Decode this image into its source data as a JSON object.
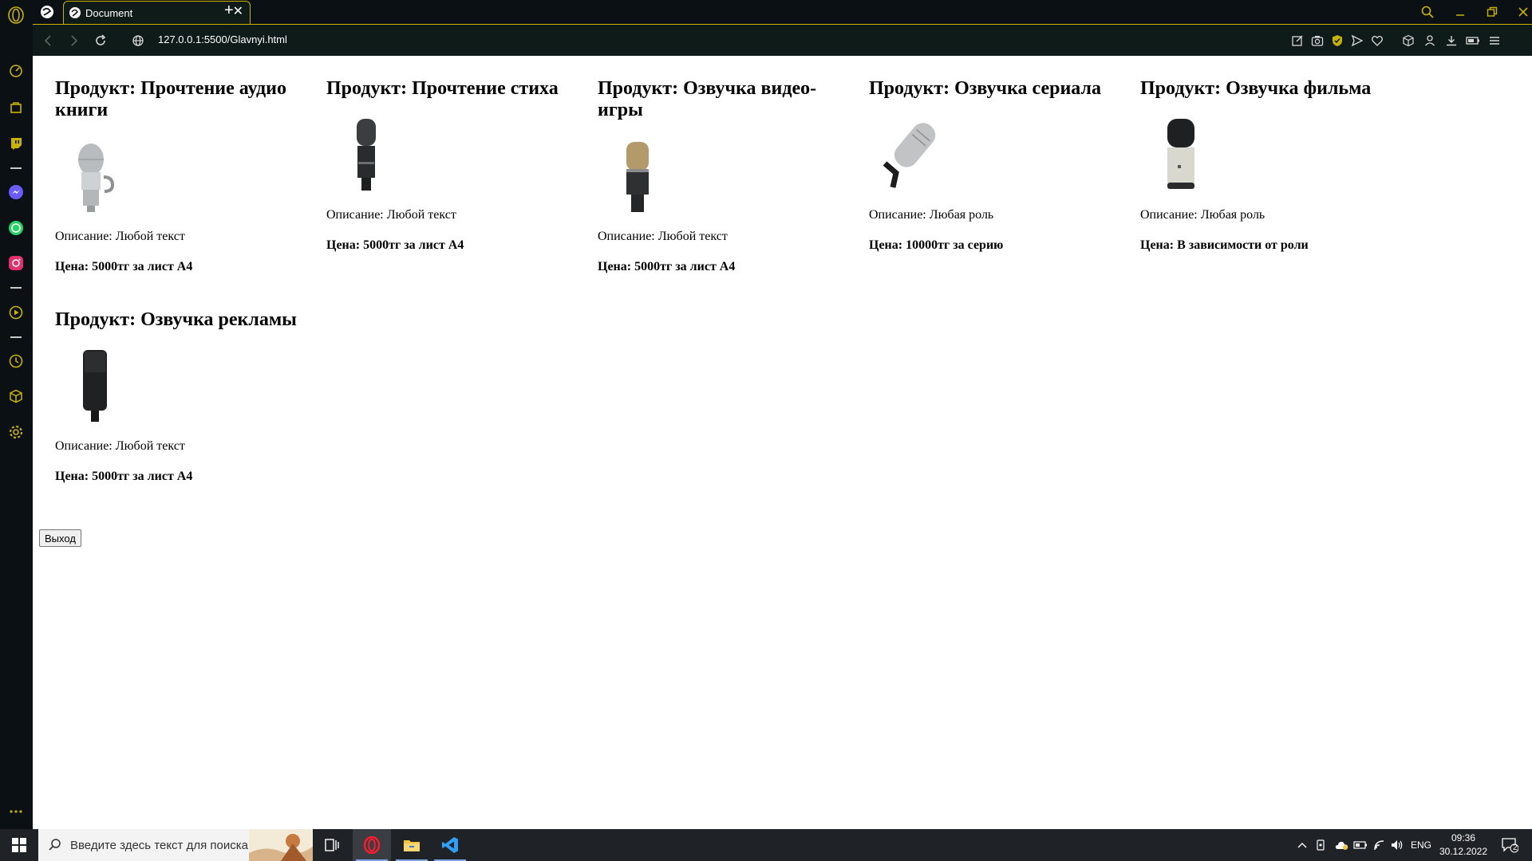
{
  "browser": {
    "tab_title": "Document",
    "url": "127.0.0.1:5500/Glavnyi.html",
    "accent": "#c8b400"
  },
  "products": [
    {
      "title": "Продукт: Прочтение аудио книги",
      "description": "Описание: Любой текст",
      "price": "Цена: 5000тг за лист А4",
      "image": "vintage-silver-microphone"
    },
    {
      "title": "Продукт: Прочтение стиха",
      "description": "Описание: Любой текст",
      "price": "Цена: 5000тг за лист А4",
      "image": "dark-slim-microphone"
    },
    {
      "title": "Продукт: Озвучка видео-игры",
      "description": "Описание: Любой текст",
      "price": "Цена: 5000тг за лист А4",
      "image": "gold-grille-microphone"
    },
    {
      "title": "Продукт: Озвучка сериала",
      "description": "Описание: Любая роль",
      "price": "Цена: 10000тг за серию",
      "image": "silver-usb-microphone-on-stand"
    },
    {
      "title": "Продукт: Озвучка фильма",
      "description": "Описание: Любая роль",
      "price": "Цена: В зависимости от роли",
      "image": "black-silver-studio-microphone"
    },
    {
      "title": "Продукт: Озвучка рекламы",
      "description": "Описание: Любой текст",
      "price": "Цена: 5000тг за лист А4",
      "image": "black-condenser-microphone"
    }
  ],
  "exit_button": "Выход",
  "taskbar": {
    "search_placeholder": "Введите здесь текст для поиска",
    "lang": "ENG",
    "time": "09:36",
    "date": "30.12.2022",
    "notifications": "2"
  }
}
